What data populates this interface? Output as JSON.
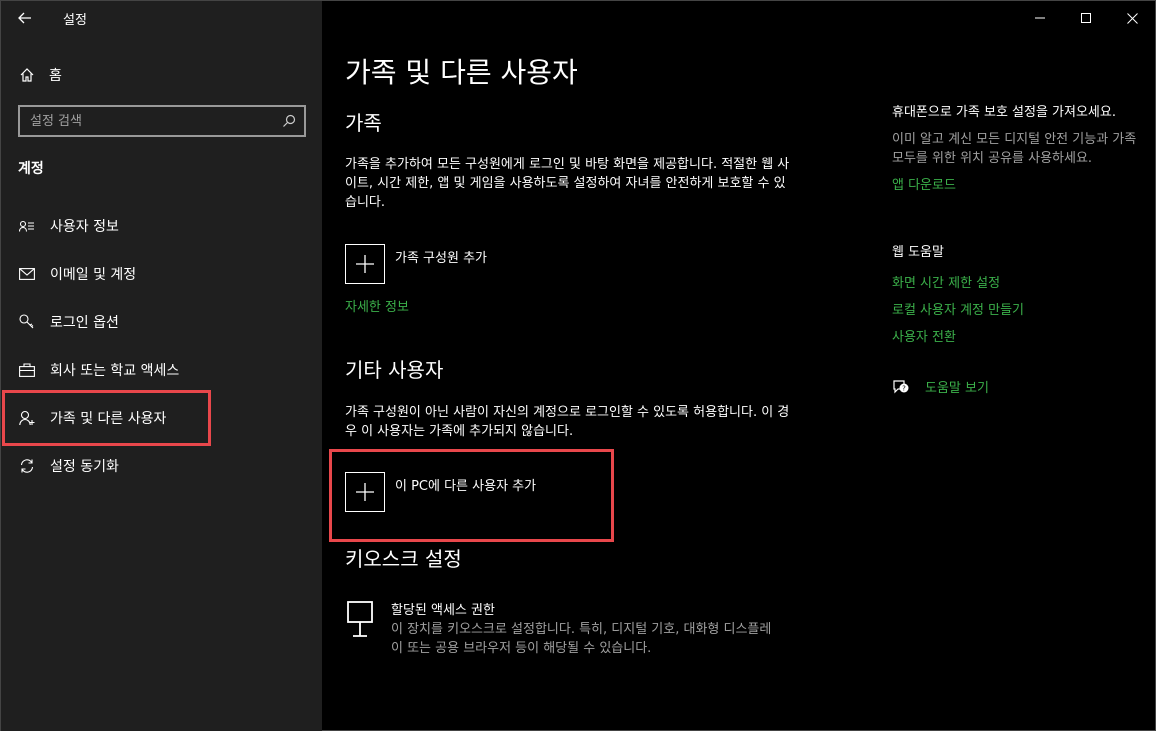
{
  "app": {
    "title": "설정"
  },
  "sidebar": {
    "home_label": "홈",
    "search_placeholder": "설정 검색",
    "section_title": "계정",
    "items": [
      {
        "label": "사용자 정보",
        "icon": "user-info-icon"
      },
      {
        "label": "이메일 및 계정",
        "icon": "mail-icon"
      },
      {
        "label": "로그인 옵션",
        "icon": "key-icon"
      },
      {
        "label": "회사 또는 학교 액세스",
        "icon": "briefcase-icon"
      },
      {
        "label": "가족 및 다른 사용자",
        "icon": "person-add-icon"
      },
      {
        "label": "설정 동기화",
        "icon": "sync-icon"
      }
    ]
  },
  "main": {
    "page_title": "가족 및 다른 사용자",
    "family": {
      "heading": "가족",
      "description": "가족을 추가하여 모든 구성원에게 로그인 및 바탕 화면을 제공합니다. 적절한 웹 사이트, 시간 제한, 앱 및 게임을 사용하도록 설정하여 자녀를 안전하게 보호할 수 있습니다.",
      "add_label": "가족 구성원 추가",
      "learn_more": "자세한 정보"
    },
    "other_users": {
      "heading": "기타 사용자",
      "description": "가족 구성원이 아닌 사람이 자신의 계정으로 로그인할 수 있도록 허용합니다. 이 경우 이 사용자는 가족에 추가되지 않습니다.",
      "add_label": "이 PC에 다른 사용자 추가"
    },
    "kiosk": {
      "heading": "키오스크 설정",
      "title": "할당된 액세스 권한",
      "description": "이 장치를 키오스크로 설정합니다. 특히, 디지털 기호, 대화형 디스플레이 또는 공용 브라우저 등이 해당될 수 있습니다."
    }
  },
  "right_panel": {
    "phone_title": "휴대폰으로 가족 보호 설정을 가져오세요.",
    "phone_desc": "이미 알고 계신 모든 디지털 안전 기능과 가족 모두를 위한 위치 공유를 사용하세요.",
    "app_download": "앱 다운로드",
    "web_help_title": "웹 도움말",
    "links": [
      "화면 시간 제한 설정",
      "로컬 사용자 계정 만들기",
      "사용자 전환"
    ],
    "get_help": "도움말 보기"
  },
  "colors": {
    "accent_link": "#3bb04a",
    "highlight": "#e8474b",
    "sidebar_bg": "#1f1f1f",
    "main_bg": "#000000"
  }
}
